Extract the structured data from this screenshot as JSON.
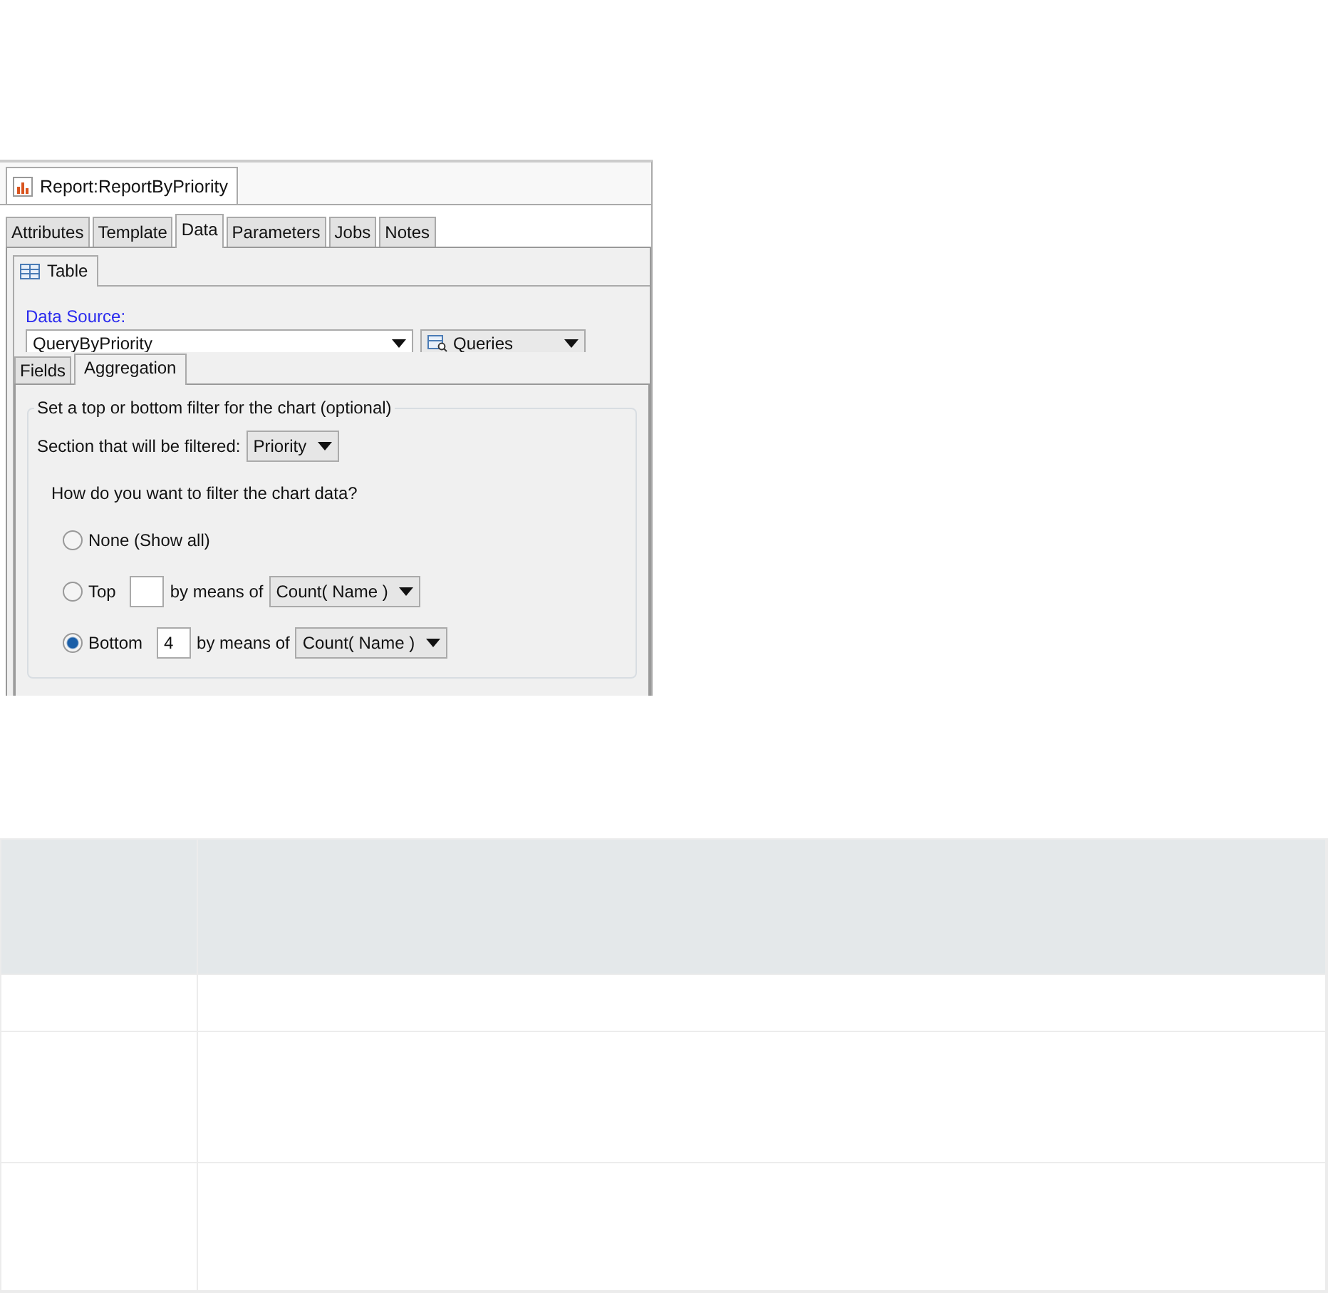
{
  "editor": {
    "title": "Report:ReportByPriority"
  },
  "tabs": [
    {
      "label": "Attributes",
      "selected": false
    },
    {
      "label": "Template",
      "selected": false
    },
    {
      "label": "Data",
      "selected": true
    },
    {
      "label": "Parameters",
      "selected": false
    },
    {
      "label": "Jobs",
      "selected": false
    },
    {
      "label": "Notes",
      "selected": false
    }
  ],
  "sub_tabs": [
    {
      "label": "Table",
      "selected": true
    }
  ],
  "data_source": {
    "label": "Data Source:",
    "value": "QueryByPriority",
    "type_value": "Queries"
  },
  "inner_tabs": [
    {
      "label": "Fields",
      "selected": false
    },
    {
      "label": "Aggregation",
      "selected": true
    }
  ],
  "filter": {
    "legend": "Set a top or bottom filter for the chart (optional)",
    "section_label": "Section that will be filtered:",
    "section_value": "Priority",
    "question": "How do you want to filter the chart data?",
    "options": [
      {
        "kind": "plain",
        "label": "None (Show all)",
        "selected": false
      },
      {
        "kind": "count",
        "label": "Top",
        "selected": false,
        "means_label": "by means of",
        "means_value": "Count( Name )"
      },
      {
        "kind": "count",
        "label": "Bottom",
        "selected": true,
        "count": "4",
        "means_label": "by means of",
        "means_value": "Count( Name )"
      }
    ]
  }
}
